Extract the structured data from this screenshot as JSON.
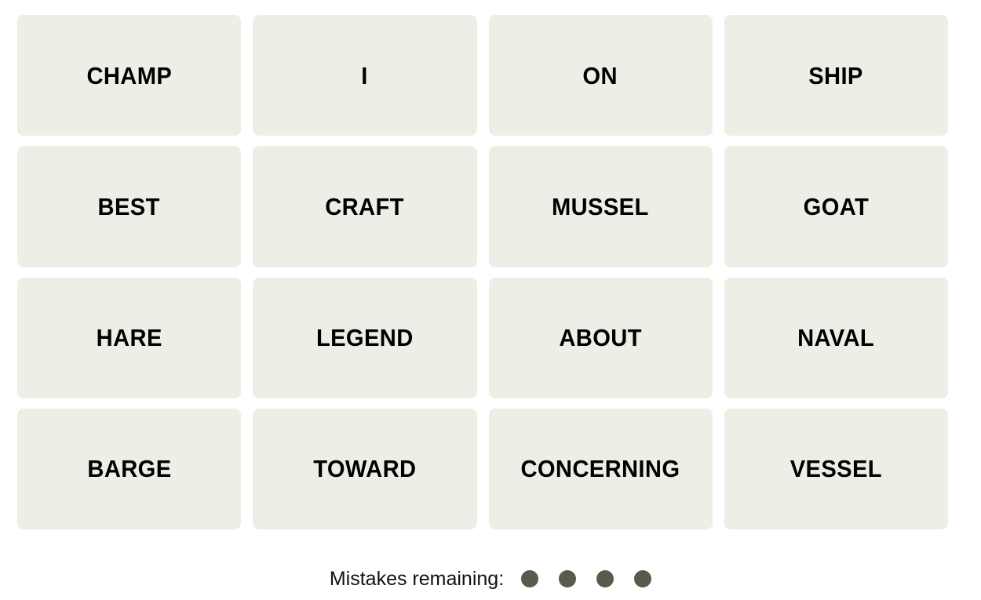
{
  "board": {
    "columns": 4,
    "rows": 4,
    "tile_color": "#EFEEE6",
    "tile_text_color": "#000000",
    "page_background": "#FFFFFF",
    "tiles": [
      {
        "word": "CHAMP"
      },
      {
        "word": "I"
      },
      {
        "word": "ON"
      },
      {
        "word": "SHIP"
      },
      {
        "word": "BEST"
      },
      {
        "word": "CRAFT"
      },
      {
        "word": "MUSSEL"
      },
      {
        "word": "GOAT"
      },
      {
        "word": "HARE"
      },
      {
        "word": "LEGEND"
      },
      {
        "word": "ABOUT"
      },
      {
        "word": "NAVAL"
      },
      {
        "word": "BARGE"
      },
      {
        "word": "TOWARD"
      },
      {
        "word": "CONCERNING"
      },
      {
        "word": "VESSEL"
      }
    ]
  },
  "mistakes": {
    "label": "Mistakes remaining:",
    "count": 4,
    "dot_color": "#5A594E",
    "dots": [
      {
        "name": "mistake-dot-1"
      },
      {
        "name": "mistake-dot-2"
      },
      {
        "name": "mistake-dot-3"
      },
      {
        "name": "mistake-dot-4"
      }
    ]
  }
}
